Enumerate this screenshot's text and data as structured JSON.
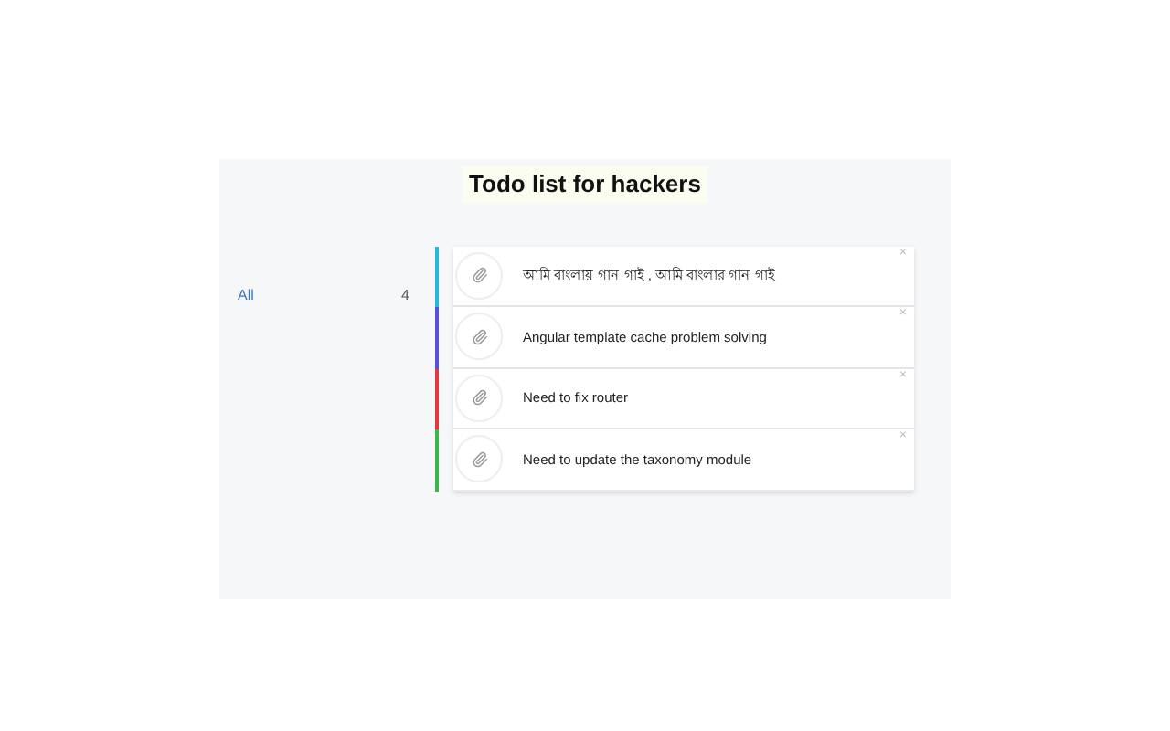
{
  "title": "Todo list for hackers",
  "sidebar": {
    "label": "All",
    "count": "4"
  },
  "todos": [
    {
      "text": "আমি বাংলায় গান গাই , আমি বাংলার গান গাই",
      "color": "#29b6d8",
      "close": "×"
    },
    {
      "text": "Angular template cache problem solving",
      "color": "#5b4fd6",
      "close": "×"
    },
    {
      "text": "Need to fix router",
      "color": "#e0393e",
      "close": "×"
    },
    {
      "text": "Need to update the taxonomy module",
      "color": "#3cb54a",
      "close": "×"
    }
  ]
}
